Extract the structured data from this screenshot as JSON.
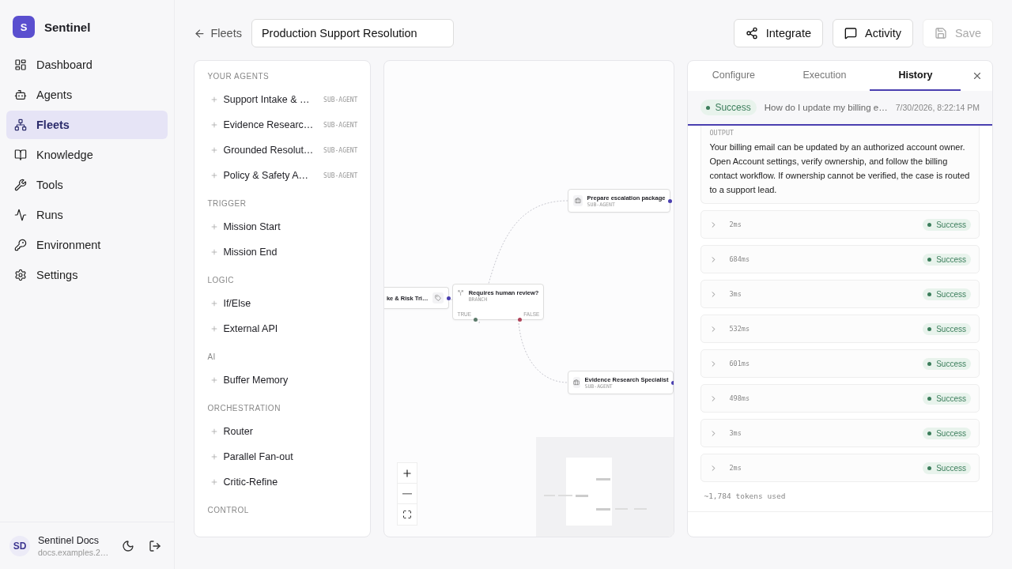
{
  "app": {
    "logo_letter": "S",
    "name": "Sentinel"
  },
  "nav": [
    {
      "label": "Dashboard",
      "selected": false
    },
    {
      "label": "Agents",
      "selected": false
    },
    {
      "label": "Fleets",
      "selected": true
    },
    {
      "label": "Knowledge",
      "selected": false
    },
    {
      "label": "Tools",
      "selected": false
    },
    {
      "label": "Runs",
      "selected": false
    },
    {
      "label": "Environment",
      "selected": false
    },
    {
      "label": "Settings",
      "selected": false
    }
  ],
  "user": {
    "initials": "SD",
    "name": "Sentinel Docs",
    "email": "docs.examples.2…"
  },
  "header": {
    "back": "Fleets",
    "title_value": "Production Support Resolution",
    "buttons": [
      {
        "label": "Integrate",
        "disabled": false
      },
      {
        "label": "Activity",
        "disabled": false
      },
      {
        "label": "Save",
        "disabled": true
      }
    ]
  },
  "palette": [
    {
      "title": "YOUR AGENTS",
      "items": [
        {
          "label": "Support Intake & …",
          "tag": "SUB-AGENT"
        },
        {
          "label": "Evidence Researc…",
          "tag": "SUB-AGENT"
        },
        {
          "label": "Grounded Resolut…",
          "tag": "SUB-AGENT"
        },
        {
          "label": "Policy & Safety A…",
          "tag": "SUB-AGENT"
        }
      ]
    },
    {
      "title": "TRIGGER",
      "items": [
        {
          "label": "Mission Start"
        },
        {
          "label": "Mission End"
        }
      ]
    },
    {
      "title": "LOGIC",
      "items": [
        {
          "label": "If/Else"
        },
        {
          "label": "External API"
        }
      ]
    },
    {
      "title": "AI",
      "items": [
        {
          "label": "Buffer Memory"
        }
      ]
    },
    {
      "title": "ORCHESTRATION",
      "items": [
        {
          "label": "Router"
        },
        {
          "label": "Parallel Fan-out"
        },
        {
          "label": "Critic-Refine"
        }
      ]
    },
    {
      "title": "CONTROL"
    }
  ],
  "canvas": {
    "nodes": [
      {
        "kind": "agent",
        "title": "ke & Risk Tri…"
      },
      {
        "kind": "branch",
        "title": "Requires human review?",
        "subtitle": "BRANCH",
        "true_label": "TRUE",
        "false_label": "FALSE"
      },
      {
        "kind": "agent",
        "title": "Prepare escalation package",
        "subtitle": "SUB-AGENT"
      },
      {
        "kind": "agent",
        "title": "Evidence Research Specialist",
        "subtitle": "SUB-AGENT"
      }
    ]
  },
  "inspector": {
    "tabs": [
      {
        "label": "Configure",
        "selected": false
      },
      {
        "label": "Execution",
        "selected": false
      },
      {
        "label": "History",
        "selected": true
      }
    ],
    "run": {
      "status": "Success",
      "query": "How do I update my billing e…",
      "time": "7/30/2026, 8:22:14 PM"
    },
    "output": {
      "label": "OUTPUT",
      "text": "Your billing email can be updated by an authorized account owner. Open Account settings, verify ownership, and follow the billing contact workflow. If ownership cannot be verified, the case is routed to a support lead."
    },
    "steps": [
      {
        "duration": "2ms",
        "status": "Success",
        "expanded": false
      },
      {
        "duration": "684ms",
        "status": "Success",
        "expanded": false
      },
      {
        "duration": "3ms",
        "status": "Success",
        "expanded": false
      },
      {
        "duration": "532ms",
        "status": "Success",
        "expanded": false
      },
      {
        "duration": "601ms",
        "status": "Success",
        "expanded": false
      },
      {
        "duration": "498ms",
        "status": "Success",
        "expanded": false
      },
      {
        "duration": "3ms",
        "status": "Success",
        "expanded": false
      },
      {
        "duration": "2ms",
        "status": "Success",
        "expanded": false
      }
    ],
    "tokens": "~1,784 tokens used"
  }
}
